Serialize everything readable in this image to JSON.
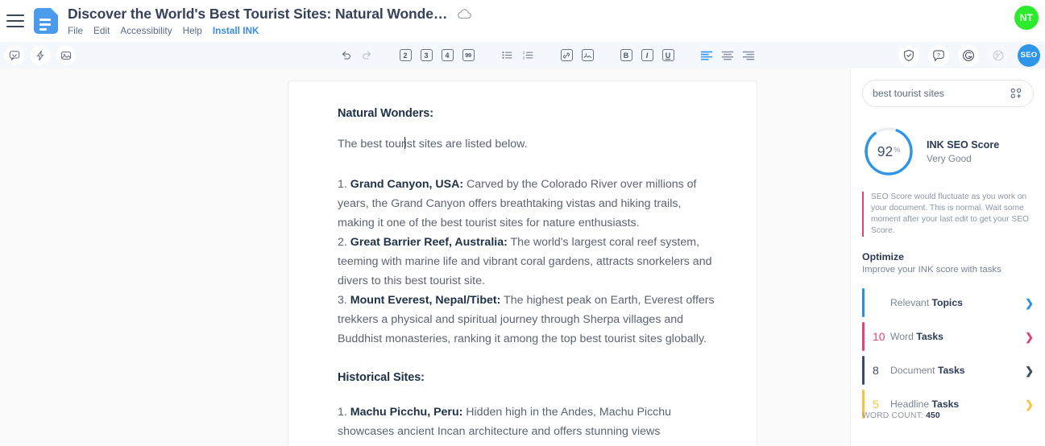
{
  "header": {
    "doc_title": "Discover the World's Best Tourist Sites: Natural Wonde…",
    "menu": [
      {
        "label": "File",
        "kind": "normal"
      },
      {
        "label": "Edit",
        "kind": "normal"
      },
      {
        "label": "Accessibility",
        "kind": "normal"
      },
      {
        "label": "Help",
        "kind": "normal"
      },
      {
        "label": "Install INK",
        "kind": "link"
      }
    ],
    "avatar_initials": "NT",
    "cloud_icon": "cloud-save-icon"
  },
  "toolbar": {
    "left_icons": [
      "comment-icon",
      "lightning-icon",
      "image-icon"
    ],
    "center": {
      "undo": "undo-icon",
      "redo": "redo-icon",
      "heading2": "2",
      "heading3": "3",
      "heading4": "4",
      "quote": "99",
      "bullet_list": "bullet-list-icon",
      "numbered_list": "numbered-list-icon",
      "link": "link-icon",
      "insert_image": "insert-image-icon",
      "bold": "B",
      "italic": "I",
      "underline": "U",
      "align_left": "align-left-icon",
      "align_center": "align-center-icon",
      "align_right": "align-right-icon"
    },
    "right_icons": [
      "shield-check-icon",
      "help-icon",
      "grammar-icon",
      "plagiarism-icon"
    ],
    "seo_button_label": "SEO"
  },
  "document": {
    "section1_heading": "Natural Wonders:",
    "intro_before_caret": "The best tour",
    "intro_after_caret": "ist sites are listed below.",
    "items1": [
      {
        "num": "1.",
        "term": "Grand Canyon, USA:",
        "text": " Carved by the Colorado River over millions of years, the Grand Canyon offers breathtaking vistas and hiking trails, making it one of the best tourist sites for nature enthusiasts."
      },
      {
        "num": "2.",
        "term": "Great Barrier Reef, Australia:",
        "text": " The world's largest coral reef system, teeming with marine life and vibrant coral gardens, attracts snorkelers and divers to this best tourist site."
      },
      {
        "num": "3.",
        "term": "Mount Everest, Nepal/Tibet:",
        "text": " The highest peak on Earth, Everest offers trekkers a physical and spiritual journey through Sherpa villages and Buddhist monasteries, ranking it among the top best tourist sites globally."
      }
    ],
    "section2_heading": "Historical Sites:",
    "items2": [
      {
        "num": "1.",
        "term": "Machu Picchu, Peru:",
        "text": " Hidden high in the Andes, Machu Picchu showcases ancient Incan architecture and offers stunning views"
      }
    ]
  },
  "seo_panel": {
    "keyword_value": "best tourist sites",
    "keyword_icon": "keywords-icon",
    "score_value": "92",
    "score_unit": "%",
    "score_title": "INK SEO Score",
    "score_rating": "Very Good",
    "note": "SEO Score would fluctuate as you work on your document. This is normal. Wait some moment after your last edit to get your SEO Score.",
    "optimize_title": "Optimize",
    "optimize_sub": "Improve your INK score with tasks",
    "tasks": [
      {
        "count": "",
        "label_light": "Relevant ",
        "label_bold": "Topics",
        "color": "#2f8fe0"
      },
      {
        "count": "10",
        "label_light": "Word ",
        "label_bold": "Tasks",
        "color": "#e0447c"
      },
      {
        "count": "8",
        "label_light": "Document ",
        "label_bold": "Tasks",
        "color": "#3c4a63"
      },
      {
        "count": "5",
        "label_light": "Headline ",
        "label_bold": "Tasks",
        "color": "#f6c344"
      }
    ],
    "word_count_label": "WORD COUNT:",
    "word_count_value": "450"
  },
  "colors": {
    "accent_blue": "#2d96e8",
    "pink": "#e0447c",
    "navy": "#3c4a63",
    "amber": "#f6c344",
    "avatar_green": "#2ceb2c"
  }
}
